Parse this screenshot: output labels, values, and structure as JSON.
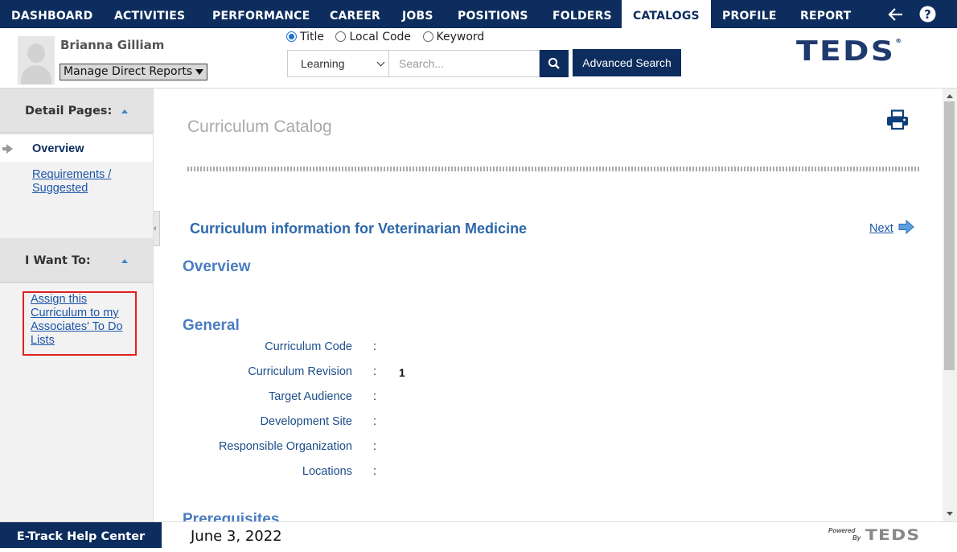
{
  "nav": {
    "items": [
      {
        "label": "DASHBOARD"
      },
      {
        "label": "ACTIVITIES"
      },
      {
        "label": "PERFORMANCE"
      },
      {
        "label": "CAREER"
      },
      {
        "label": "JOBS"
      },
      {
        "label": "POSITIONS"
      },
      {
        "label": "FOLDERS"
      },
      {
        "label": "CATALOGS"
      },
      {
        "label": "PROFILE"
      },
      {
        "label": "REPORT"
      }
    ],
    "active": "CATALOGS",
    "icons": [
      "back-arrow-icon",
      "help-icon"
    ]
  },
  "header": {
    "user_name": "Brianna Gilliam",
    "manage_reports": "Manage Direct Reports",
    "search_modes": [
      {
        "label": "Title",
        "checked": true
      },
      {
        "label": "Local Code",
        "checked": false
      },
      {
        "label": "Keyword",
        "checked": false
      }
    ],
    "category_select": "Learning",
    "search_placeholder": "Search...",
    "advanced_search": "Advanced Search",
    "logo_text": "TEDS",
    "logo_mark": "®"
  },
  "sidebar": {
    "detail_pages_title": "Detail Pages:",
    "overview": "Overview",
    "requirements_line1": "Requirements /",
    "requirements_line2": "Suggested",
    "i_want_to_title": "I Want To:",
    "assign_lines": [
      "Assign this",
      "Curriculum to my",
      "Associates' To Do",
      "Lists"
    ]
  },
  "main": {
    "page_title": "Curriculum Catalog",
    "curriculum_info": "Curriculum information for Veterinarian Medicine",
    "next_label": "Next",
    "overview_heading": "Overview",
    "general_heading": "General",
    "fields": [
      {
        "label": "Curriculum Code",
        "value": ""
      },
      {
        "label": "Curriculum Revision",
        "value": "1"
      },
      {
        "label": "Target Audience",
        "value": ""
      },
      {
        "label": "Development Site",
        "value": ""
      },
      {
        "label": "Responsible Organization",
        "value": ""
      },
      {
        "label": "Locations",
        "value": ""
      }
    ],
    "prerequisites_heading": "Prerequisites"
  },
  "footer": {
    "help_center": "E-Track Help Center",
    "date": "June 3, 2022",
    "powered_by_1": "Powered",
    "powered_by_2": "By",
    "powered_logo": "TEDS"
  },
  "colors": {
    "navy": "#0d2d5e",
    "link_blue": "#1d55a8",
    "heading_blue": "#4a7dc0",
    "highlight_red": "#e02020"
  }
}
